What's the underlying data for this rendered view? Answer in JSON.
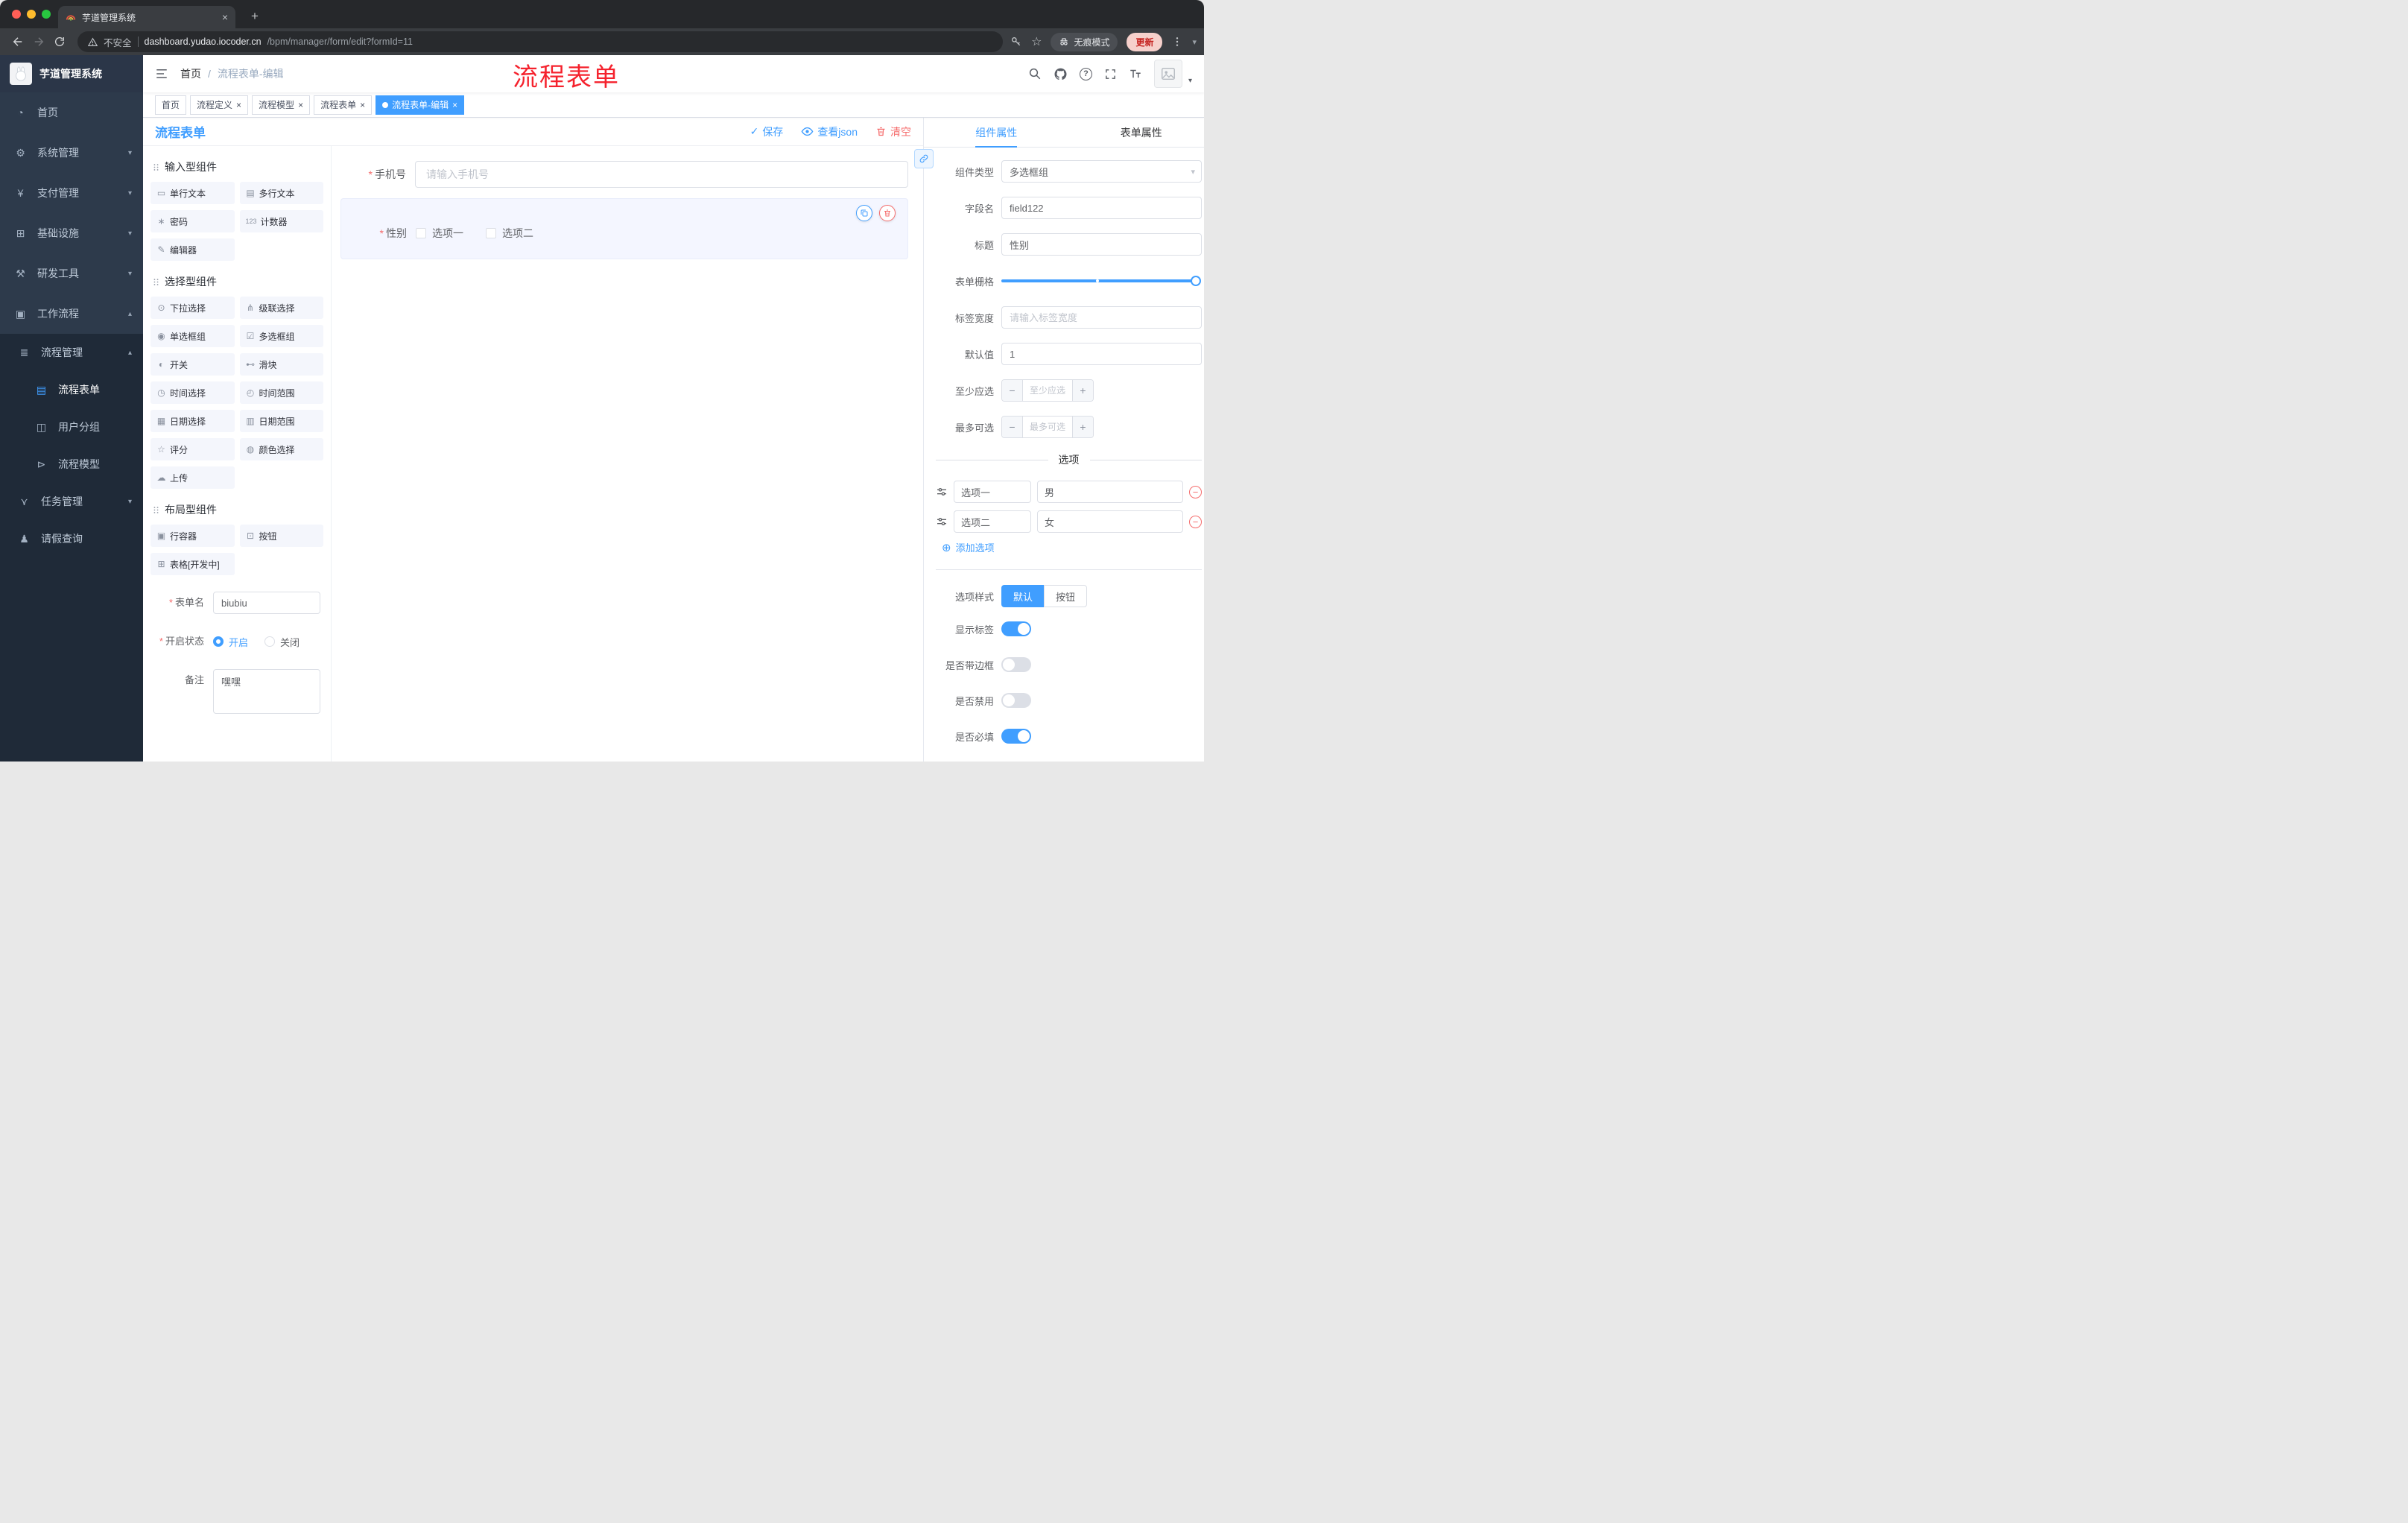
{
  "colors": {
    "accent": "#409eff",
    "danger": "#f56c6c",
    "annotation_red": "#f5222d",
    "sidebar_bg": "#2d3a4b",
    "submenu_bg": "#1f2a38",
    "active_tag_bg": "#409eff"
  },
  "browser": {
    "tab_title": "芋道管理系统",
    "security_label": "不安全",
    "url_domain": "dashboard.yudao.iocoder.cn",
    "url_path": "/bpm/manager/form/edit?formId=11",
    "incognito_label": "无痕模式",
    "update_label": "更新"
  },
  "annotation": {
    "title": "流程表单"
  },
  "sidebar": {
    "logo_title": "芋道管理系统",
    "items": {
      "home": {
        "glyph": "◔",
        "label": "首页"
      },
      "system": {
        "glyph": "⚙",
        "label": "系统管理"
      },
      "payment": {
        "glyph": "¥",
        "label": "支付管理"
      },
      "infra": {
        "glyph": "⊞",
        "label": "基础设施"
      },
      "devtools": {
        "glyph": "⚒",
        "label": "研发工具"
      },
      "workflow": {
        "glyph": "▣",
        "label": "工作流程"
      },
      "process_mgmt": {
        "glyph": "≣",
        "label": "流程管理"
      },
      "process_form": {
        "glyph": "▤",
        "label": "流程表单"
      },
      "user_group": {
        "glyph": "◫",
        "label": "用户分组"
      },
      "process_model": {
        "glyph": "⊳",
        "label": "流程模型"
      },
      "task_mgmt": {
        "glyph": "⋎",
        "label": "任务管理"
      },
      "leave_query": {
        "glyph": "♟",
        "label": "请假查询"
      }
    }
  },
  "header": {
    "breadcrumb_home": "首页",
    "breadcrumb_sep": "/",
    "breadcrumb_current": "流程表单-编辑"
  },
  "tags": {
    "t1": "首页",
    "t2": "流程定义",
    "t3": "流程模型",
    "t4": "流程表单",
    "t5": "流程表单-编辑"
  },
  "designer": {
    "title": "流程表单",
    "save": "保存",
    "view_json": "查看json",
    "clear": "清空",
    "palette": {
      "group1": "输入型组件",
      "group2": "选择型组件",
      "group3": "布局型组件",
      "g1": [
        {
          "glyph": "▭",
          "label": "单行文本"
        },
        {
          "glyph": "▤",
          "label": "多行文本"
        },
        {
          "glyph": "∗",
          "label": "密码"
        },
        {
          "glyph": "123",
          "label": "计数器"
        },
        {
          "glyph": "✎",
          "label": "编辑器"
        }
      ],
      "g2": [
        {
          "glyph": "⊙",
          "label": "下拉选择"
        },
        {
          "glyph": "⋔",
          "label": "级联选择"
        },
        {
          "glyph": "◉",
          "label": "单选框组"
        },
        {
          "glyph": "☑",
          "label": "多选框组"
        },
        {
          "glyph": "◐",
          "label": "开关"
        },
        {
          "glyph": "⊷",
          "label": "滑块"
        },
        {
          "glyph": "◷",
          "label": "时间选择"
        },
        {
          "glyph": "◴",
          "label": "时间范围"
        },
        {
          "glyph": "▦",
          "label": "日期选择"
        },
        {
          "glyph": "▥",
          "label": "日期范围"
        },
        {
          "glyph": "☆",
          "label": "评分"
        },
        {
          "glyph": "◍",
          "label": "颜色选择"
        },
        {
          "glyph": "☁",
          "label": "上传"
        }
      ],
      "g3": [
        {
          "glyph": "▣",
          "label": "行容器"
        },
        {
          "glyph": "⊡",
          "label": "按钮"
        },
        {
          "glyph": "⊞",
          "label": "表格[开发中]"
        }
      ]
    },
    "meta": {
      "form_name_label": "表单名",
      "form_name_value": "biubiu",
      "status_label": "开启状态",
      "status_on": "开启",
      "status_off": "关闭",
      "remark_label": "备注",
      "remark_value": "嘿嘿"
    },
    "canvas": {
      "phone_label": "手机号",
      "phone_placeholder": "请输入手机号",
      "gender_label": "性别",
      "option1": "选项一",
      "option2": "选项二"
    }
  },
  "props": {
    "tab_component": "组件属性",
    "tab_form": "表单属性",
    "rows": {
      "component_type": {
        "label": "组件类型",
        "value": "多选框组"
      },
      "field_name": {
        "label": "字段名",
        "value": "field122"
      },
      "title": {
        "label": "标题",
        "value": "性别"
      },
      "grid": {
        "label": "表单栅格"
      },
      "label_width": {
        "label": "标签宽度",
        "placeholder": "请输入标签宽度"
      },
      "default_value": {
        "label": "默认值",
        "value": "1"
      },
      "min_select": {
        "label": "至少应选",
        "placeholder": "至少应选"
      },
      "max_select": {
        "label": "最多可选",
        "placeholder": "最多可选"
      }
    },
    "options_title": "选项",
    "options": [
      {
        "label": "选项一",
        "value": "男"
      },
      {
        "label": "选项二",
        "value": "女"
      }
    ],
    "add_option": "添加选项",
    "option_style": {
      "label": "选项样式",
      "default": "默认",
      "button": "按钮",
      "active": "默认"
    },
    "toggles": {
      "show_label": {
        "label": "显示标签",
        "on": true
      },
      "border": {
        "label": "是否带边框",
        "on": false
      },
      "disabled": {
        "label": "是否禁用",
        "on": false
      },
      "required": {
        "label": "是否必填",
        "on": true
      }
    }
  }
}
